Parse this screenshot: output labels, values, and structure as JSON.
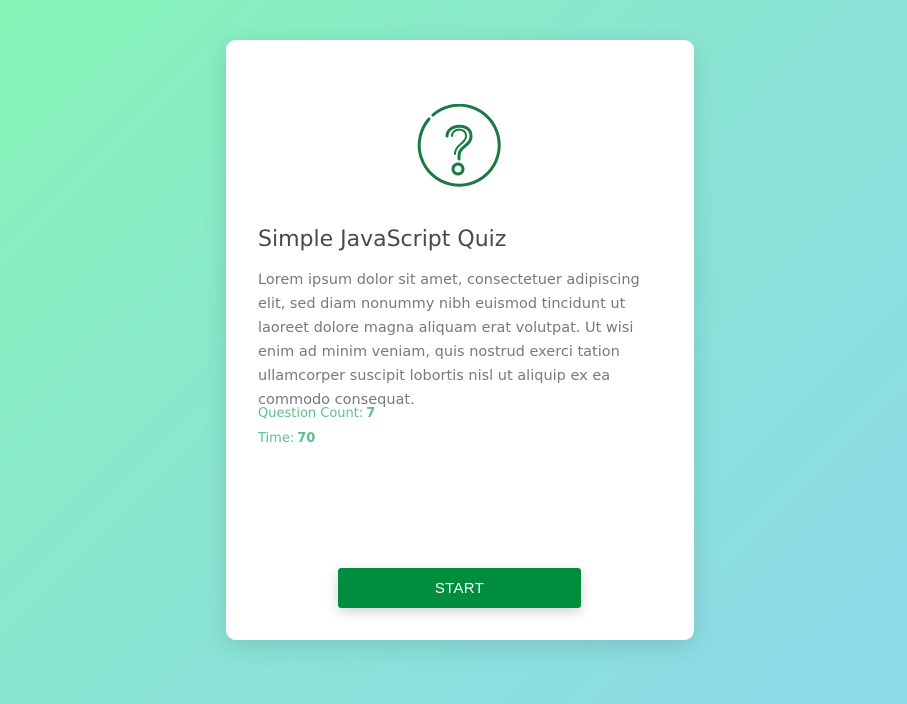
{
  "quiz": {
    "icon": "question-circle-icon",
    "title": "Simple JavaScript Quiz",
    "description": "Lorem ipsum dolor sit amet, consectetuer adipiscing elit, sed diam nonummy nibh euismod tincidunt ut laoreet dolore magna aliquam erat volutpat. Ut wisi enim ad minim veniam, quis nostrud exerci tation ullamcorper suscipit lobortis nisl ut aliquip ex ea commodo consequat.",
    "question_count_label": "Question Count:",
    "question_count": "7",
    "time_label": "Time:",
    "time": "70",
    "start_label": "START"
  },
  "colors": {
    "accent": "#008d3d",
    "icon": "#1a7a45",
    "meta_text": "#5dbf8a"
  }
}
